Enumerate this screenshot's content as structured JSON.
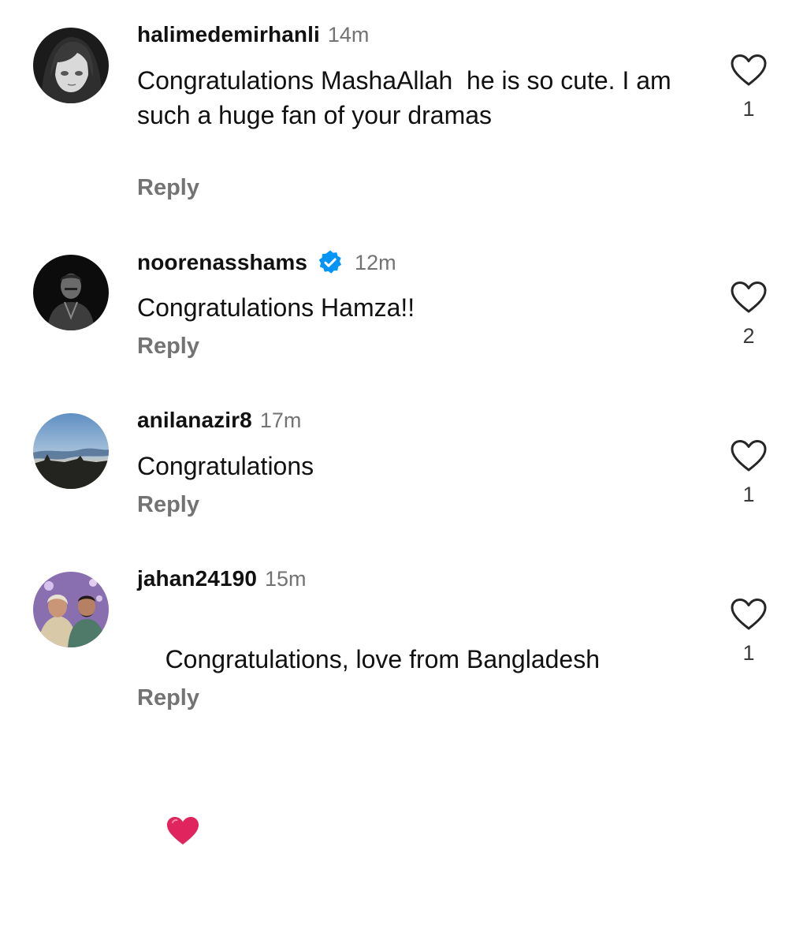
{
  "comments": [
    {
      "username": "halimedemirhanli",
      "time": "14m",
      "verified": false,
      "text": "Congratulations MashaAllah  he is so cute. I am such a huge fan of your dramas",
      "reply_label": "Reply",
      "likes": "1",
      "avatar_icon": "anime-girl-avatar"
    },
    {
      "username": "noorenasshams",
      "time": "12m",
      "verified": true,
      "text": "Congratulations Hamza!!",
      "reply_label": "Reply",
      "likes": "2",
      "avatar_icon": "dark-portrait-avatar"
    },
    {
      "username": "anilanazir8",
      "time": "17m",
      "verified": false,
      "text": "Congratulations",
      "reply_label": "Reply",
      "likes": "1",
      "avatar_icon": "sunset-landscape-avatar"
    },
    {
      "username": "jahan24190",
      "time": "15m",
      "verified": false,
      "text": "Congratulations, love from Bangladesh",
      "emoji": "red-heart-emoji",
      "reply_label": "Reply",
      "likes": "1",
      "avatar_icon": "couple-photo-avatar"
    }
  ],
  "colors": {
    "text": "#111111",
    "muted": "#737373",
    "verified_blue": "#0095F6",
    "heart_red": "#E0245E"
  }
}
